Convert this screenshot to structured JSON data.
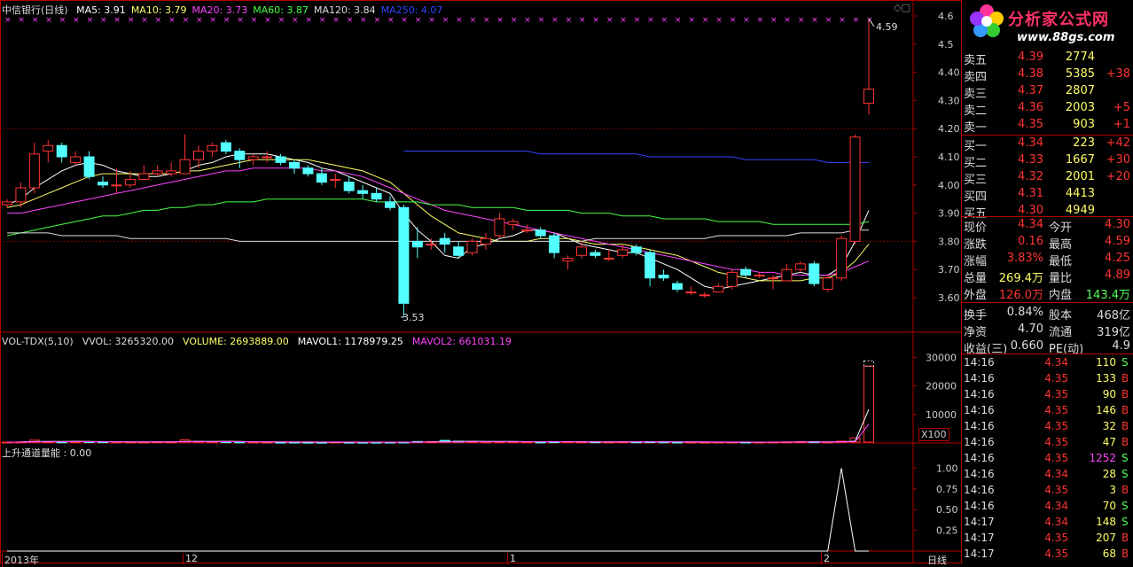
{
  "title_bar": {
    "stock_name": "中信银行(日线)",
    "ma_items": [
      {
        "label": "MA5: 3.91",
        "color": "#ffffff"
      },
      {
        "label": "MA10: 3.79",
        "color": "#ffff66"
      },
      {
        "label": "MA20: 3.73",
        "color": "#ff44ff"
      },
      {
        "label": "MA60: 3.87",
        "color": "#44ff44"
      },
      {
        "label": "MA120: 3.84",
        "color": "#dddddd"
      },
      {
        "label": "MA250: 4.07",
        "color": "#3344ff"
      }
    ]
  },
  "volume_bar": {
    "items": [
      {
        "label": "VOL-TDX(5,10)",
        "color": "#dddddd"
      },
      {
        "label": "VVOL: 3265320.00",
        "color": "#dddddd"
      },
      {
        "label": "VOLUME: 2693889.00",
        "color": "#ffff66"
      },
      {
        "label": "MAVOL1: 1178979.25",
        "color": "#ffffff"
      },
      {
        "label": "MAVOL2: 661031.19",
        "color": "#ff44ff"
      }
    ],
    "unit": "X100"
  },
  "indicator_bar": {
    "label": "上升通道量能 : 0.00"
  },
  "axis_labels": {
    "price_ticks": [
      "4.6",
      "4.5",
      "4.40",
      "4.30",
      "4.20",
      "4.10",
      "4.00",
      "3.90",
      "3.80",
      "3.70",
      "3.60"
    ],
    "volume_ticks": [
      "30000",
      "20000",
      "10000"
    ],
    "indicator_ticks": [
      "1.00",
      "0.75",
      "0.50",
      "0.25"
    ],
    "bottom_dates": [
      "2013年",
      "12",
      "1",
      "2"
    ],
    "period_label": "日线"
  },
  "annotations": {
    "high": "4.59",
    "low": "3.53"
  },
  "colors": {
    "up": "#ff3333",
    "down": "#54ffff",
    "frame": "#b00000",
    "grid": "#7a0000"
  },
  "logo": {
    "name": "分析家公式网",
    "url": "www.88gs.com"
  },
  "order_book": {
    "asks": [
      {
        "label": "卖五",
        "price": "4.39",
        "vol": "2774",
        "chg": ""
      },
      {
        "label": "卖四",
        "price": "4.38",
        "vol": "5385",
        "chg": "+38"
      },
      {
        "label": "卖三",
        "price": "4.37",
        "vol": "2807",
        "chg": ""
      },
      {
        "label": "卖二",
        "price": "4.36",
        "vol": "2003",
        "chg": "+5"
      },
      {
        "label": "卖一",
        "price": "4.35",
        "vol": "903",
        "chg": "+1"
      }
    ],
    "bids": [
      {
        "label": "买一",
        "price": "4.34",
        "vol": "223",
        "chg": "+42"
      },
      {
        "label": "买二",
        "price": "4.33",
        "vol": "1667",
        "chg": "+30"
      },
      {
        "label": "买三",
        "price": "4.32",
        "vol": "2001",
        "chg": "+20"
      },
      {
        "label": "买四",
        "price": "4.31",
        "vol": "4413",
        "chg": ""
      },
      {
        "label": "买五",
        "price": "4.30",
        "vol": "4949",
        "chg": ""
      }
    ]
  },
  "quote_info": [
    {
      "l1": "现价",
      "v1": "4.34",
      "c1": "#ff3333",
      "l2": "今开",
      "v2": "4.30",
      "c2": "#ff3333"
    },
    {
      "l1": "涨跌",
      "v1": "0.16",
      "c1": "#ff3333",
      "l2": "最高",
      "v2": "4.59",
      "c2": "#ff3333"
    },
    {
      "l1": "涨幅",
      "v1": "3.83%",
      "c1": "#ff3333",
      "l2": "最低",
      "v2": "4.25",
      "c2": "#ff3333"
    },
    {
      "l1": "总量",
      "v1": "269.4万",
      "c1": "#ffff66",
      "l2": "量比",
      "v2": "4.89",
      "c2": "#ff3333"
    },
    {
      "l1": "外盘",
      "v1": "126.0万",
      "c1": "#ff3333",
      "l2": "内盘",
      "v2": "143.4万",
      "c2": "#54ff54"
    },
    {
      "l1": "换手",
      "v1": "0.84%",
      "c1": "#dddddd",
      "l2": "股本",
      "v2": "468亿",
      "c2": "#dddddd"
    },
    {
      "l1": "净资",
      "v1": "4.70",
      "c1": "#dddddd",
      "l2": "流通",
      "v2": "319亿",
      "c2": "#dddddd"
    },
    {
      "l1": "收益(三)",
      "v1": "0.660",
      "c1": "#dddddd",
      "l2": "PE(动)",
      "v2": "4.9",
      "c2": "#dddddd"
    }
  ],
  "ticks": [
    {
      "time": "14:16",
      "price": "4.34",
      "vol": "110",
      "side": "S"
    },
    {
      "time": "14:16",
      "price": "4.35",
      "vol": "133",
      "side": "B"
    },
    {
      "time": "14:16",
      "price": "4.35",
      "vol": "90",
      "side": "B"
    },
    {
      "time": "14:16",
      "price": "4.35",
      "vol": "146",
      "side": "B"
    },
    {
      "time": "14:16",
      "price": "4.35",
      "vol": "32",
      "side": "B"
    },
    {
      "time": "14:16",
      "price": "4.35",
      "vol": "47",
      "side": "B"
    },
    {
      "time": "14:16",
      "price": "4.35",
      "vol": "1252",
      "side": "S"
    },
    {
      "time": "14:16",
      "price": "4.34",
      "vol": "28",
      "side": "S"
    },
    {
      "time": "14:16",
      "price": "4.35",
      "vol": "3",
      "side": "B"
    },
    {
      "time": "14:16",
      "price": "4.34",
      "vol": "70",
      "side": "S"
    },
    {
      "time": "14:17",
      "price": "4.34",
      "vol": "148",
      "side": "S"
    },
    {
      "time": "14:17",
      "price": "4.35",
      "vol": "207",
      "side": "B"
    },
    {
      "time": "14:17",
      "price": "4.35",
      "vol": "68",
      "side": "B"
    }
  ],
  "chart_data": {
    "type": "candlestick",
    "ylim": [
      3.5,
      4.62
    ],
    "candles": [
      [
        3.93,
        3.95,
        3.92,
        3.94
      ],
      [
        3.94,
        4.01,
        3.92,
        3.99
      ],
      [
        3.99,
        4.15,
        3.97,
        4.11
      ],
      [
        4.12,
        4.16,
        4.08,
        4.14
      ],
      [
        4.14,
        4.15,
        4.08,
        4.1
      ],
      [
        4.08,
        4.12,
        4.07,
        4.1
      ],
      [
        4.1,
        4.12,
        4.02,
        4.03
      ],
      [
        4.01,
        4.03,
        3.99,
        4.0
      ],
      [
        4.0,
        4.06,
        3.97,
        4.0
      ],
      [
        4.0,
        4.05,
        3.99,
        4.02
      ],
      [
        4.02,
        4.07,
        4.02,
        4.04
      ],
      [
        4.04,
        4.07,
        4.03,
        4.05
      ],
      [
        4.04,
        4.08,
        4.03,
        4.05
      ],
      [
        4.04,
        4.18,
        4.04,
        4.09
      ],
      [
        4.09,
        4.14,
        4.06,
        4.12
      ],
      [
        4.12,
        4.15,
        4.1,
        4.14
      ],
      [
        4.15,
        4.16,
        4.11,
        4.12
      ],
      [
        4.12,
        4.13,
        4.06,
        4.09
      ],
      [
        4.09,
        4.11,
        4.07,
        4.1
      ],
      [
        4.1,
        4.12,
        4.08,
        4.1
      ],
      [
        4.1,
        4.11,
        4.07,
        4.08
      ],
      [
        4.08,
        4.09,
        4.04,
        4.06
      ],
      [
        4.06,
        4.07,
        4.03,
        4.04
      ],
      [
        4.04,
        4.06,
        4.0,
        4.01
      ],
      [
        4.02,
        4.04,
        3.99,
        4.02
      ],
      [
        4.01,
        4.03,
        3.97,
        3.98
      ],
      [
        3.98,
        4.0,
        3.95,
        3.97
      ],
      [
        3.97,
        3.99,
        3.94,
        3.95
      ],
      [
        3.94,
        3.96,
        3.91,
        3.92
      ],
      [
        3.92,
        3.93,
        3.53,
        3.58
      ],
      [
        3.8,
        3.85,
        3.74,
        3.78
      ],
      [
        3.79,
        3.81,
        3.77,
        3.79
      ],
      [
        3.81,
        3.83,
        3.76,
        3.79
      ],
      [
        3.78,
        3.8,
        3.74,
        3.75
      ],
      [
        3.76,
        3.81,
        3.75,
        3.8
      ],
      [
        3.79,
        3.83,
        3.77,
        3.81
      ],
      [
        3.82,
        3.9,
        3.81,
        3.88
      ],
      [
        3.86,
        3.88,
        3.84,
        3.87
      ],
      [
        3.84,
        3.86,
        3.83,
        3.84
      ],
      [
        3.84,
        3.85,
        3.81,
        3.82
      ],
      [
        3.82,
        3.83,
        3.74,
        3.76
      ],
      [
        3.73,
        3.75,
        3.7,
        3.74
      ],
      [
        3.75,
        3.8,
        3.74,
        3.78
      ],
      [
        3.76,
        3.77,
        3.74,
        3.75
      ],
      [
        3.74,
        3.77,
        3.73,
        3.74
      ],
      [
        3.75,
        3.79,
        3.74,
        3.77
      ],
      [
        3.78,
        3.79,
        3.75,
        3.76
      ],
      [
        3.76,
        3.77,
        3.64,
        3.67
      ],
      [
        3.68,
        3.7,
        3.66,
        3.67
      ],
      [
        3.65,
        3.66,
        3.62,
        3.63
      ],
      [
        3.62,
        3.64,
        3.61,
        3.62
      ],
      [
        3.61,
        3.62,
        3.6,
        3.61
      ],
      [
        3.62,
        3.65,
        3.62,
        3.64
      ],
      [
        3.64,
        3.7,
        3.63,
        3.69
      ],
      [
        3.7,
        3.71,
        3.67,
        3.68
      ],
      [
        3.68,
        3.69,
        3.67,
        3.68
      ],
      [
        3.67,
        3.68,
        3.63,
        3.67
      ],
      [
        3.66,
        3.72,
        3.66,
        3.7
      ],
      [
        3.7,
        3.73,
        3.69,
        3.72
      ],
      [
        3.72,
        3.73,
        3.64,
        3.65
      ],
      [
        3.63,
        3.68,
        3.62,
        3.67
      ],
      [
        3.67,
        3.82,
        3.66,
        3.81
      ],
      [
        3.8,
        4.18,
        3.79,
        4.17
      ],
      [
        4.29,
        4.59,
        4.25,
        4.34
      ]
    ],
    "ma_lines": [
      {
        "name": "MA5",
        "color": "#ffffff",
        "values": [
          3.93,
          3.95,
          3.99,
          4.02,
          4.05,
          4.07,
          4.08,
          4.07,
          4.05,
          4.04,
          4.03,
          4.03,
          4.04,
          4.05,
          4.07,
          4.08,
          4.1,
          4.11,
          4.11,
          4.11,
          4.1,
          4.09,
          4.08,
          4.06,
          4.05,
          4.03,
          4.01,
          3.99,
          3.97,
          3.9,
          3.84,
          3.8,
          3.75,
          3.74,
          3.78,
          3.79,
          3.81,
          3.82,
          3.84,
          3.84,
          3.83,
          3.81,
          3.79,
          3.78,
          3.77,
          3.76,
          3.76,
          3.74,
          3.72,
          3.7,
          3.67,
          3.64,
          3.63,
          3.64,
          3.65,
          3.66,
          3.67,
          3.68,
          3.69,
          3.68,
          3.68,
          3.71,
          3.8,
          3.91
        ]
      },
      {
        "name": "MA10",
        "color": "#ffff66",
        "values": [
          3.92,
          3.93,
          3.95,
          3.97,
          3.99,
          4.01,
          4.03,
          4.04,
          4.04,
          4.04,
          4.04,
          4.04,
          4.04,
          4.05,
          4.05,
          4.06,
          4.07,
          4.08,
          4.09,
          4.09,
          4.09,
          4.09,
          4.09,
          4.08,
          4.07,
          4.06,
          4.05,
          4.03,
          4.01,
          3.97,
          3.93,
          3.89,
          3.86,
          3.83,
          3.82,
          3.81,
          3.8,
          3.8,
          3.8,
          3.81,
          3.81,
          3.81,
          3.8,
          3.79,
          3.79,
          3.79,
          3.78,
          3.77,
          3.76,
          3.75,
          3.73,
          3.71,
          3.69,
          3.68,
          3.67,
          3.66,
          3.66,
          3.66,
          3.66,
          3.67,
          3.67,
          3.69,
          3.73,
          3.79
        ]
      },
      {
        "name": "MA20",
        "color": "#ff44ff",
        "values": [
          3.9,
          3.9,
          3.91,
          3.92,
          3.93,
          3.94,
          3.95,
          3.96,
          3.97,
          3.98,
          3.99,
          4.0,
          4.01,
          4.02,
          4.03,
          4.04,
          4.05,
          4.05,
          4.06,
          4.06,
          4.06,
          4.06,
          4.06,
          4.05,
          4.05,
          4.04,
          4.03,
          4.01,
          3.99,
          3.97,
          3.95,
          3.93,
          3.91,
          3.9,
          3.89,
          3.88,
          3.87,
          3.86,
          3.85,
          3.84,
          3.83,
          3.82,
          3.81,
          3.8,
          3.79,
          3.78,
          3.77,
          3.76,
          3.75,
          3.74,
          3.73,
          3.72,
          3.71,
          3.7,
          3.7,
          3.69,
          3.69,
          3.68,
          3.68,
          3.68,
          3.68,
          3.69,
          3.71,
          3.73
        ]
      },
      {
        "name": "MA60",
        "color": "#44ff44",
        "values": [
          3.82,
          3.83,
          3.84,
          3.85,
          3.86,
          3.87,
          3.88,
          3.89,
          3.89,
          3.9,
          3.91,
          3.91,
          3.92,
          3.92,
          3.93,
          3.93,
          3.94,
          3.94,
          3.94,
          3.95,
          3.95,
          3.95,
          3.95,
          3.95,
          3.95,
          3.95,
          3.95,
          3.94,
          3.94,
          3.94,
          3.94,
          3.93,
          3.93,
          3.93,
          3.92,
          3.92,
          3.92,
          3.92,
          3.91,
          3.91,
          3.91,
          3.91,
          3.9,
          3.9,
          3.9,
          3.89,
          3.89,
          3.89,
          3.88,
          3.88,
          3.88,
          3.88,
          3.87,
          3.87,
          3.87,
          3.87,
          3.86,
          3.86,
          3.86,
          3.86,
          3.86,
          3.86,
          3.86,
          3.87
        ]
      },
      {
        "name": "MA120",
        "color": "#dddddd",
        "values": [
          3.83,
          3.83,
          3.83,
          3.83,
          3.82,
          3.82,
          3.82,
          3.82,
          3.82,
          3.81,
          3.81,
          3.81,
          3.81,
          3.81,
          3.81,
          3.81,
          3.81,
          3.8,
          3.8,
          3.8,
          3.8,
          3.8,
          3.8,
          3.8,
          3.8,
          3.8,
          3.8,
          3.8,
          3.8,
          3.8,
          3.8,
          3.8,
          3.8,
          3.8,
          3.8,
          3.8,
          3.8,
          3.8,
          3.8,
          3.8,
          3.8,
          3.8,
          3.8,
          3.81,
          3.81,
          3.81,
          3.81,
          3.81,
          3.81,
          3.81,
          3.81,
          3.81,
          3.82,
          3.82,
          3.82,
          3.82,
          3.82,
          3.82,
          3.83,
          3.83,
          3.83,
          3.83,
          3.84,
          3.84
        ]
      },
      {
        "name": "MA250",
        "color": "#3344ff",
        "start": 29,
        "values": [
          4.12,
          4.12,
          4.12,
          4.12,
          4.12,
          4.12,
          4.12,
          4.12,
          4.12,
          4.12,
          4.11,
          4.11,
          4.11,
          4.11,
          4.11,
          4.11,
          4.11,
          4.11,
          4.1,
          4.1,
          4.1,
          4.1,
          4.1,
          4.1,
          4.1,
          4.09,
          4.09,
          4.09,
          4.09,
          4.09,
          4.09,
          4.08,
          4.08,
          4.08,
          4.08
        ]
      }
    ],
    "volume": [
      310,
      380,
      990,
      420,
      380,
      460,
      480,
      420,
      340,
      320,
      300,
      420,
      360,
      1100,
      560,
      480,
      420,
      360,
      310,
      280,
      280,
      300,
      270,
      260,
      300,
      280,
      260,
      270,
      290,
      320,
      520,
      480,
      900,
      620,
      480,
      380,
      420,
      460,
      380,
      340,
      420,
      480,
      380,
      400,
      320,
      420,
      380,
      420,
      380,
      320,
      280,
      260,
      280,
      300,
      320,
      280,
      320,
      380,
      480,
      420,
      300,
      640,
      1800,
      26939
    ],
    "volume_ylim": [
      0,
      32000
    ],
    "mavol1": [
      300,
      350,
      500,
      520,
      520,
      580,
      560,
      460,
      420,
      380,
      360,
      360,
      360,
      520,
      540,
      560,
      580,
      520,
      430,
      380,
      330,
      310,
      290,
      280,
      280,
      280,
      280,
      270,
      270,
      280,
      320,
      360,
      460,
      540,
      580,
      560,
      560,
      540,
      460,
      440,
      420,
      420,
      420,
      400,
      400,
      400,
      390,
      390,
      380,
      380,
      360,
      330,
      300,
      280,
      280,
      280,
      290,
      310,
      340,
      360,
      360,
      400,
      620,
      11790
    ],
    "mavol2": [
      300,
      320,
      400,
      430,
      440,
      460,
      470,
      450,
      430,
      410,
      400,
      380,
      380,
      420,
      440,
      450,
      460,
      470,
      450,
      430,
      410,
      390,
      370,
      350,
      340,
      330,
      320,
      310,
      300,
      300,
      310,
      320,
      360,
      400,
      420,
      430,
      440,
      450,
      440,
      430,
      420,
      420,
      410,
      410,
      400,
      400,
      400,
      390,
      390,
      380,
      370,
      360,
      350,
      340,
      330,
      320,
      320,
      330,
      340,
      350,
      350,
      370,
      450,
      6610
    ],
    "indicator": [
      0,
      0,
      0,
      0,
      0,
      0,
      0,
      0,
      0,
      0,
      0,
      0,
      0,
      0,
      0,
      0,
      0,
      0,
      0,
      0,
      0,
      0,
      0,
      0,
      0,
      0,
      0,
      0,
      0,
      0,
      0,
      0,
      0,
      0,
      0,
      0,
      0,
      0,
      0,
      0,
      0,
      0,
      0,
      0,
      0,
      0,
      0,
      0,
      0,
      0,
      0,
      0,
      0,
      0,
      0,
      0,
      0,
      0,
      0,
      0,
      0,
      1,
      0,
      0
    ],
    "indicator_ylim": [
      0,
      1.1
    ]
  }
}
